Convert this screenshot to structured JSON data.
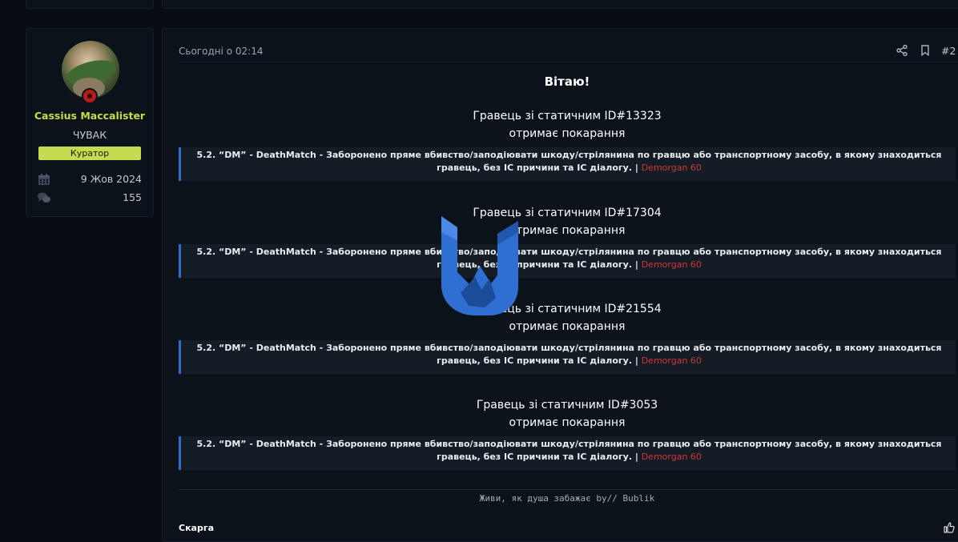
{
  "user": {
    "name": "Cassius Maccalister",
    "title": "ЧУВАК",
    "role": "Куратор",
    "joined": "9 Жов 2024",
    "messages": "155",
    "joined_icon": "calendar-icon",
    "messages_icon": "chat-bubbles-icon"
  },
  "post": {
    "date": "Сьогодні о 02:14",
    "number": "#2",
    "greeting": "Вітаю!",
    "penalties": [
      {
        "line1": "Гравець зі статичним ID#13323",
        "line2": "отримає покарання",
        "rule": "5.2. “DM” - DeathMatch - Заборонено пряме вбивство/заподіювати шкоду/стрілянина по гравцю або транспортному засобу, в якому знаходиться гравець, без IC причини та IC діалогу. |",
        "punishment": "Demorgan 60"
      },
      {
        "line1": "Гравець зі статичним ID#17304",
        "line2": "отримає покарання",
        "rule": "5.2. “DM” - DeathMatch - Заборонено пряме вбивство/заподіювати шкоду/стрілянина по гравцю або транспортному засобу, в якому знаходиться гравець, без IC причини та IC діалогу. |",
        "punishment": "Demorgan 60"
      },
      {
        "line1": "Гравець зі статичним ID#21554",
        "line2": "отримає покарання",
        "rule": "5.2. “DM” - DeathMatch - Заборонено пряме вбивство/заподіювати шкоду/стрілянина по гравцю або транспортному засобу, в якому знаходиться гравець, без IC причини та IC діалогу. |",
        "punishment": "Demorgan 60"
      },
      {
        "line1": "Гравець зі статичним ID#3053",
        "line2": "отримає покарання",
        "rule": "5.2. “DM” - DeathMatch - Заборонено пряме вбивство/заподіювати шкоду/стрілянина по гравцю або транспортному засобу, в якому знаходиться гравець, без IC причини та IC діалогу. |",
        "punishment": "Demorgan 60"
      }
    ],
    "signature": "Живи, як душа забажає by// Bublik",
    "report_label": "Скарга"
  },
  "colors": {
    "background": "#080d14",
    "panel": "#0b121a",
    "username": "#c8dc4a",
    "role_badge": "#c6dc50",
    "quote_border": "#2f6ecd",
    "punishment": "#d43535",
    "status_dot": "#b81b1b",
    "watermark": "#2e6fd1"
  }
}
